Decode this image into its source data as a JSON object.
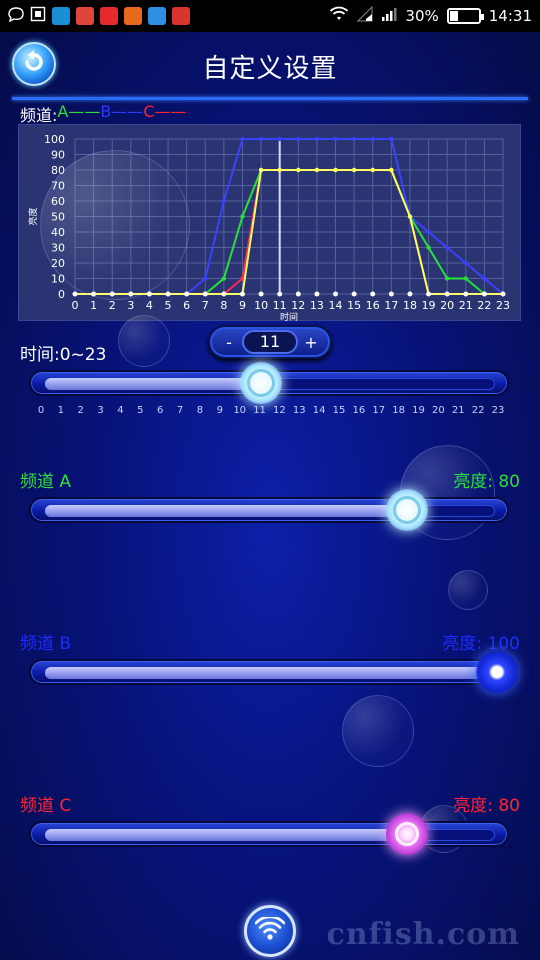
{
  "status_bar": {
    "battery": "30%",
    "battery_level": 0.3,
    "time": "14:31"
  },
  "header": {
    "title": "自定义设置",
    "back_icon": "back-arrow-icon"
  },
  "legend": {
    "label": "频道:",
    "a": "A——",
    "b": "B——",
    "c": "C——"
  },
  "colors": {
    "channel_a": "#27e03a",
    "channel_b": "#2d3bff",
    "channel_c": "#ff2430",
    "combined": "#ffff66"
  },
  "chart_data": {
    "type": "line",
    "ylabel": "亮度",
    "xlabel": "时间",
    "x": [
      0,
      1,
      2,
      3,
      4,
      5,
      6,
      7,
      8,
      9,
      10,
      11,
      12,
      13,
      14,
      15,
      16,
      17,
      18,
      19,
      20,
      21,
      22,
      23
    ],
    "ylim": [
      0,
      100
    ],
    "yticks": [
      0,
      10,
      20,
      30,
      40,
      50,
      60,
      70,
      80,
      90,
      100
    ],
    "marker_x": 11,
    "grid": true,
    "series": [
      {
        "name": "B",
        "color": "#3a42ff",
        "values": [
          0,
          0,
          0,
          0,
          0,
          0,
          0,
          10,
          60,
          100,
          100,
          100,
          100,
          100,
          100,
          100,
          100,
          100,
          50,
          40,
          30,
          20,
          10,
          0
        ]
      },
      {
        "name": "C",
        "color": "#ff2a55",
        "values": [
          0,
          0,
          0,
          0,
          0,
          0,
          0,
          0,
          0,
          10,
          80,
          80,
          80,
          80,
          80,
          80,
          80,
          80,
          50,
          0,
          0,
          0,
          0,
          0
        ]
      },
      {
        "name": "A",
        "color": "#27e03a",
        "values": [
          0,
          0,
          0,
          0,
          0,
          0,
          0,
          0,
          10,
          50,
          80,
          80,
          80,
          80,
          80,
          80,
          80,
          80,
          50,
          30,
          10,
          10,
          0,
          0
        ]
      },
      {
        "name": "",
        "color": "#ffff66",
        "values": [
          0,
          0,
          0,
          0,
          0,
          0,
          0,
          0,
          0,
          0,
          80,
          80,
          80,
          80,
          80,
          80,
          80,
          80,
          50,
          0,
          0,
          0,
          0,
          0
        ]
      }
    ]
  },
  "time_section": {
    "label": "时间:0~23",
    "minus": "-",
    "plus": "+",
    "value": "11",
    "slider_value": 11,
    "slider_max": 23,
    "ticks": [
      "0",
      "1",
      "2",
      "3",
      "4",
      "5",
      "6",
      "7",
      "8",
      "9",
      "10",
      "11",
      "12",
      "13",
      "14",
      "15",
      "16",
      "17",
      "18",
      "19",
      "20",
      "21",
      "22",
      "23"
    ]
  },
  "channels": [
    {
      "label": "频道 A",
      "value_text": "亮度: 80",
      "value": 80,
      "color": "#27e03a"
    },
    {
      "label": "频道 B",
      "value_text": "亮度: 100",
      "value": 100,
      "color": "#1f2cff"
    },
    {
      "label": "频道 C",
      "value_text": "亮度: 80",
      "value": 80,
      "color": "#ff2430"
    }
  ],
  "footer": {
    "wifi_icon": "wifi-icon",
    "watermark": "cnfish.com"
  }
}
